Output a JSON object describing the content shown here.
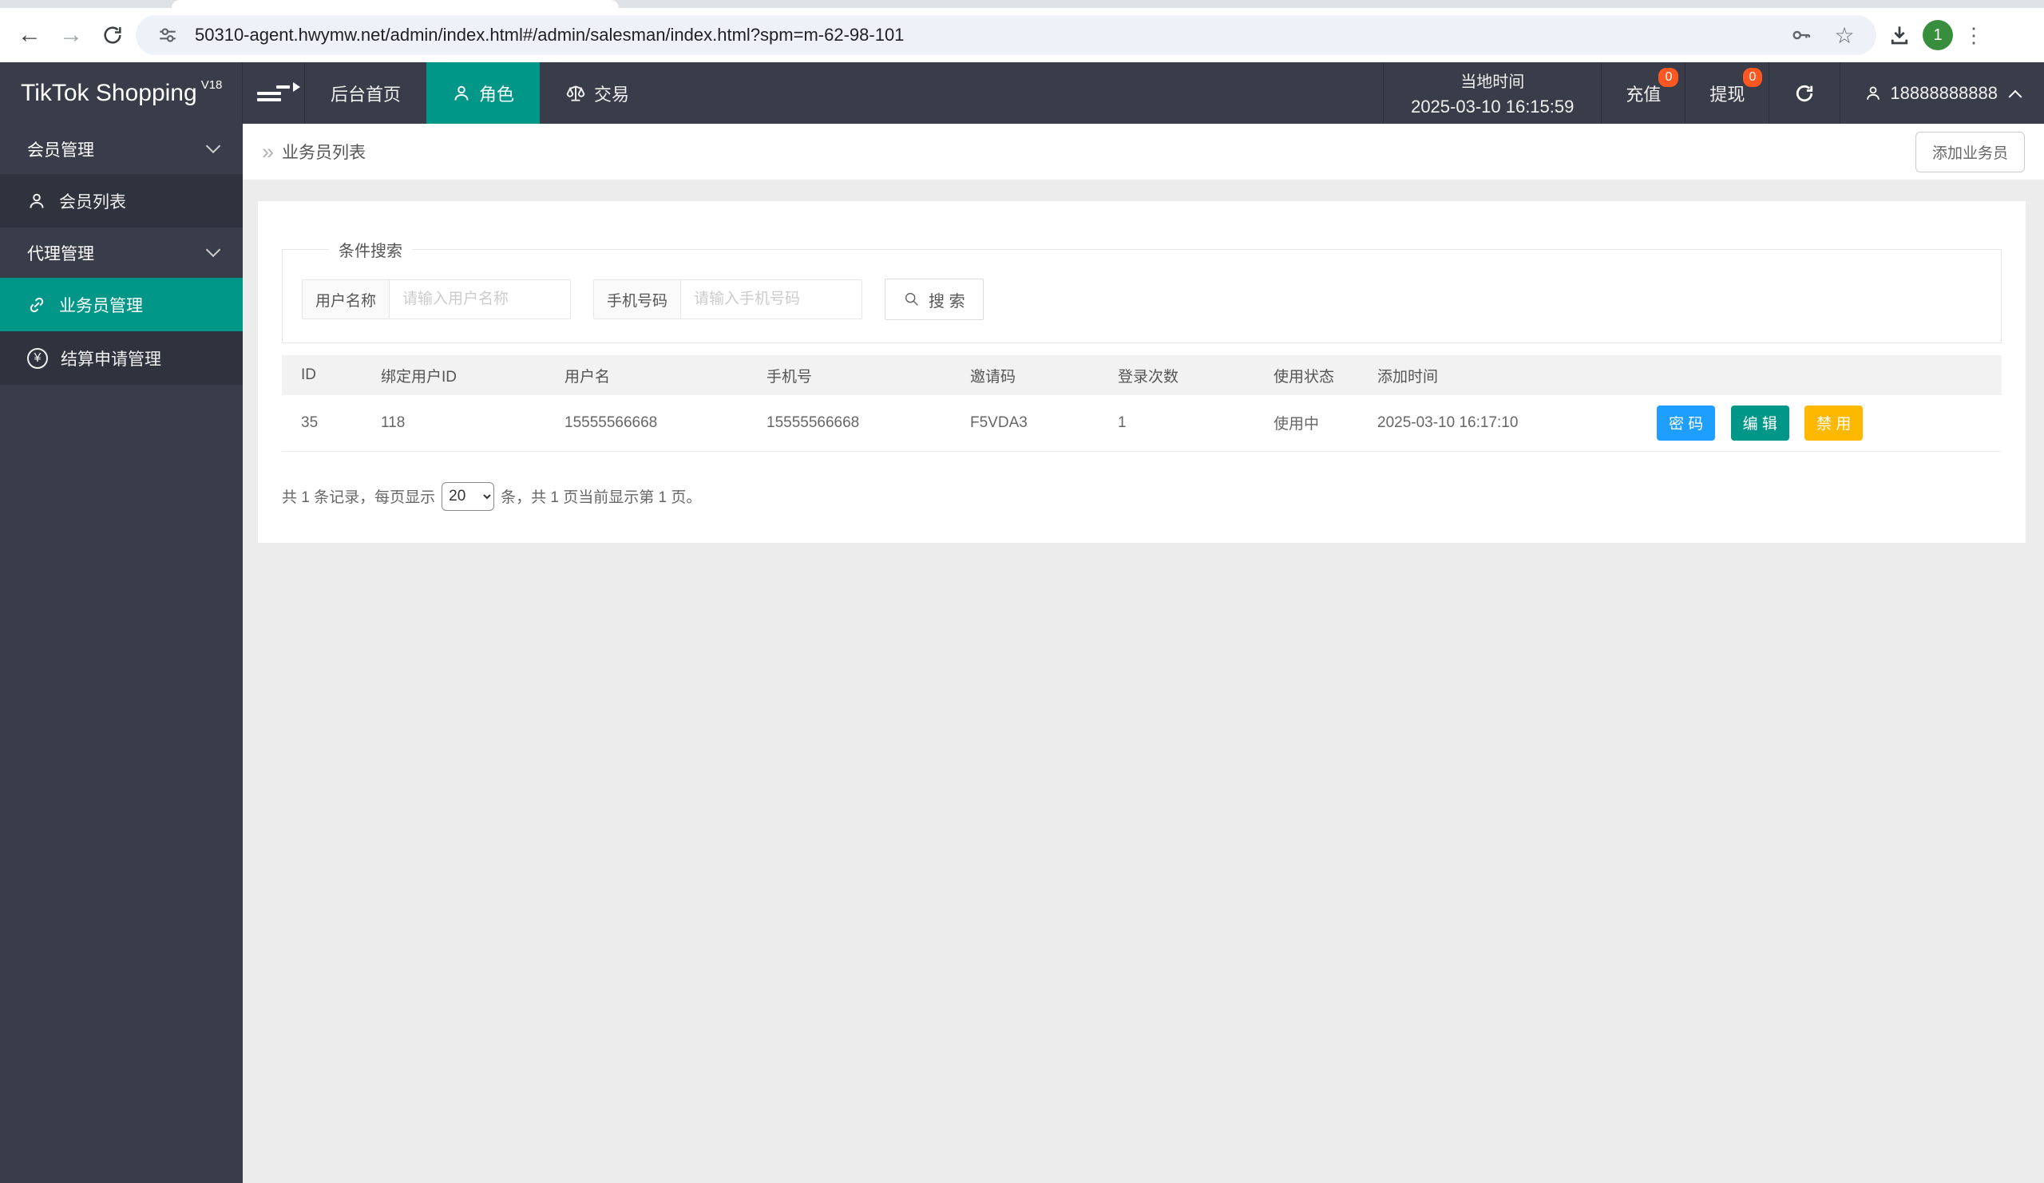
{
  "browser": {
    "url": "50310-agent.hwymw.net/admin/index.html#/admin/salesman/index.html?spm=m-62-98-101",
    "avatar_label": "1"
  },
  "icons": {
    "back": "←",
    "forward": "→",
    "star": "☆",
    "kebab": "⋮",
    "yen": "¥",
    "breadcrumb_caret": "»"
  },
  "navbar": {
    "brand": "TikTok Shopping",
    "brand_sup": "V18",
    "tabs": [
      {
        "label": "后台首页",
        "active": false
      },
      {
        "label": "角色",
        "active": true
      },
      {
        "label": "交易",
        "active": false
      }
    ],
    "time_label": "当地时间",
    "time_value": "2025-03-10 16:15:59",
    "recharge_label": "充值",
    "recharge_badge": "0",
    "withdraw_label": "提现",
    "withdraw_badge": "0",
    "account": "18888888888"
  },
  "sidebar": {
    "groups": [
      {
        "label": "会员管理",
        "items": [
          {
            "label": "会员列表",
            "icon": "person-icon",
            "active": false
          }
        ]
      },
      {
        "label": "代理管理",
        "items": [
          {
            "label": "业务员管理",
            "icon": "link-icon",
            "active": true
          },
          {
            "label": "结算申请管理",
            "icon": "yen-circle-icon",
            "active": false
          }
        ]
      }
    ]
  },
  "page": {
    "breadcrumb": "业务员列表",
    "add_button": "添加业务员",
    "search": {
      "legend": "条件搜索",
      "username_label": "用户名称",
      "username_placeholder": "请输入用户名称",
      "username_value": "",
      "phone_label": "手机号码",
      "phone_placeholder": "请输入手机号码",
      "phone_value": "",
      "button": "搜 索"
    },
    "table": {
      "headers": [
        "ID",
        "绑定用户ID",
        "用户名",
        "手机号",
        "邀请码",
        "登录次数",
        "使用状态",
        "添加时间",
        ""
      ],
      "rows": [
        {
          "id": "35",
          "bind_user_id": "118",
          "username": "15555566668",
          "phone": "15555566668",
          "invite_code": "F5VDA3",
          "login_count": "1",
          "status": "使用中",
          "added_at": "2025-03-10 16:17:10",
          "actions": {
            "password": "密 码",
            "edit": "编 辑",
            "disable": "禁 用"
          }
        }
      ]
    },
    "pagination": {
      "total_prefix": "共 1 条记录，每页显示",
      "page_size": "20",
      "total_suffix": "条，共 1 页当前显示第 1 页。"
    }
  },
  "colors": {
    "accent": "#009688",
    "navbar-bg": "#393D49",
    "submenu-bg": "#2F333D",
    "badge": "#FF5722",
    "btn-blue": "#1E9FFF",
    "btn-warn": "#FFB800",
    "status-green": "#1faa1f",
    "avatar-green": "#388E3C"
  }
}
